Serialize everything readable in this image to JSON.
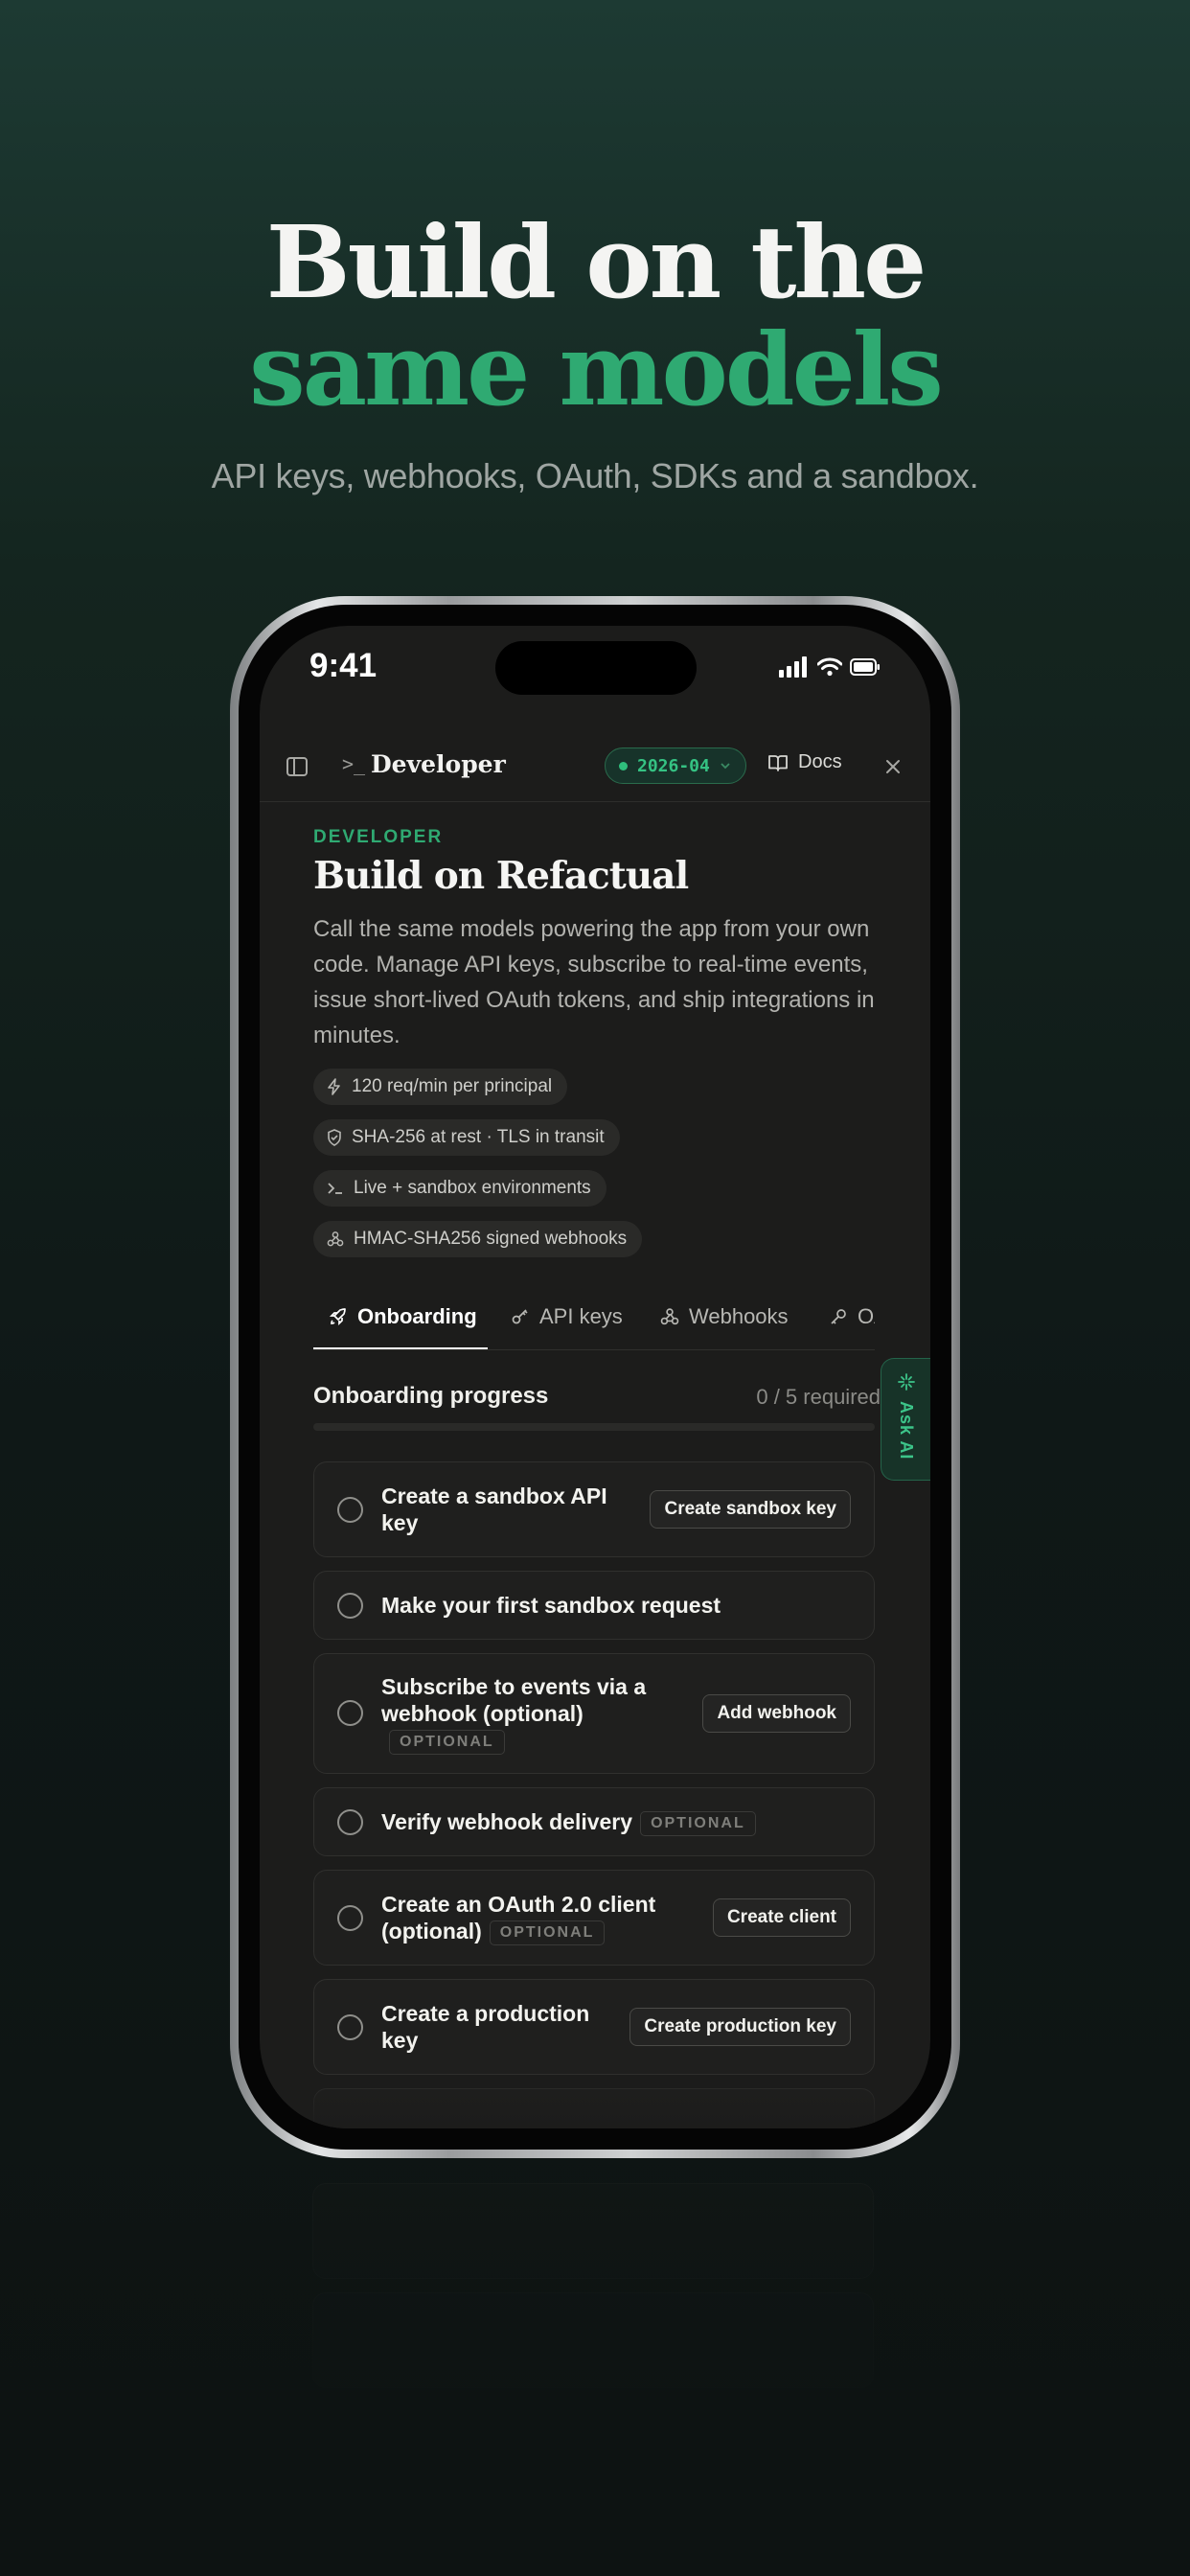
{
  "hero": {
    "line1": "Build on the",
    "line2": "same models",
    "subtitle": "API keys, webhooks, OAuth, SDKs and a sandbox."
  },
  "status_bar": {
    "time": "9:41"
  },
  "topbar": {
    "prompt": ">_",
    "title": "Developer",
    "version": "2026-04",
    "docs_label": "Docs"
  },
  "page": {
    "eyebrow": "DEVELOPER",
    "title": "Build on Refactual",
    "description": "Call the same models powering the app from your own code. Manage API keys, subscribe to real-time events, issue short-lived OAuth tokens, and ship integrations in minutes."
  },
  "pills": [
    {
      "icon": "lightning-icon",
      "label": "120 req/min per principal"
    },
    {
      "icon": "shield-icon",
      "label": "SHA-256 at rest · TLS in transit"
    },
    {
      "icon": "terminal-icon",
      "label": "Live + sandbox environments"
    },
    {
      "icon": "webhook-icon",
      "label": "HMAC-SHA256 signed webhooks"
    }
  ],
  "tabs": [
    {
      "icon": "rocket-icon",
      "label": "Onboarding",
      "active": true
    },
    {
      "icon": "key-icon",
      "label": "API keys"
    },
    {
      "icon": "webhook-icon",
      "label": "Webhooks"
    },
    {
      "icon": "key-icon",
      "label": "OAuth"
    }
  ],
  "progress": {
    "title": "Onboarding progress",
    "count": "0 / 5 required",
    "value": 0
  },
  "ask_ai": "Ask AI",
  "optional_tag": "OPTIONAL",
  "steps": [
    {
      "title": "Create a sandbox API key",
      "optional": false,
      "button": "Create sandbox key"
    },
    {
      "title": "Make your first sandbox request",
      "optional": false,
      "button": null
    },
    {
      "title": "Subscribe to events via a webhook (optional)",
      "optional": true,
      "button": "Add webhook"
    },
    {
      "title": "Verify webhook delivery",
      "optional": true,
      "button": null
    },
    {
      "title": "Create an OAuth 2.0 client (optional)",
      "optional": true,
      "button": "Create client"
    },
    {
      "title": "Create a production key",
      "optional": false,
      "button": "Create production key"
    }
  ],
  "colors": {
    "accent": "#2faa72",
    "background": "#0f1817",
    "screen": "#1c1c1b"
  }
}
